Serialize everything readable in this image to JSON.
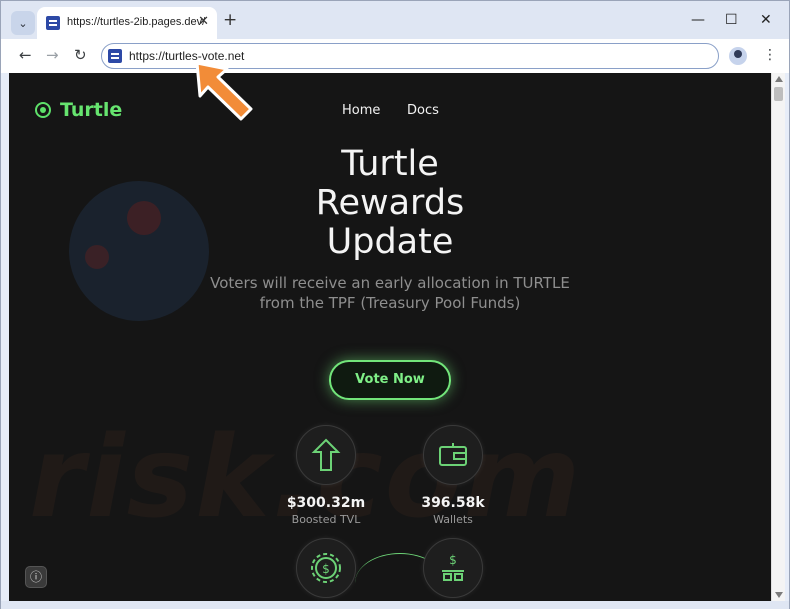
{
  "browser": {
    "tab_title": "https://turtles-2ib.pages.dev/",
    "tab_close": "✕",
    "new_tab": "+",
    "url": "https://turtles-vote.net",
    "icons": [
      "tab-menu-icon",
      "favicon-icon",
      "back-arrow-icon",
      "forward-arrow-icon",
      "reload-icon",
      "site-info-icon",
      "profile-icon",
      "kebab-menu-icon",
      "minimize-icon",
      "maximize-icon",
      "close-icon"
    ],
    "controls": {
      "back": "←",
      "forward": "→",
      "reload": "↻",
      "minimize": "—",
      "maximize": "☐",
      "close": "✕",
      "menu": "⋮",
      "tab_menu": "⌄"
    }
  },
  "site": {
    "brand": "Turtle",
    "nav": [
      "Home",
      "Docs"
    ],
    "hero": {
      "title_line1": "Turtle",
      "title_line2": "Rewards",
      "title_line3": "Update",
      "subtitle_line1": "Voters will receive an early allocation in TURTLE",
      "subtitle_line2": "from the TPF (Treasury Pool Funds)"
    },
    "cta": "Vote Now",
    "stats": [
      {
        "value": "$300.32m",
        "label": "Boosted TVL",
        "icon": "arrow-up-icon"
      },
      {
        "value": "396.58k",
        "label": "Wallets",
        "icon": "wallet-icon"
      }
    ],
    "feature_icons": [
      "gear-dollar-icon",
      "dollar-bars-icon"
    ],
    "info_button": "ⓘ"
  },
  "watermark": "risk.com",
  "colors": {
    "accent": "#66e46f",
    "page_bg": "#151515",
    "annotation_arrow": "#f28c38"
  }
}
